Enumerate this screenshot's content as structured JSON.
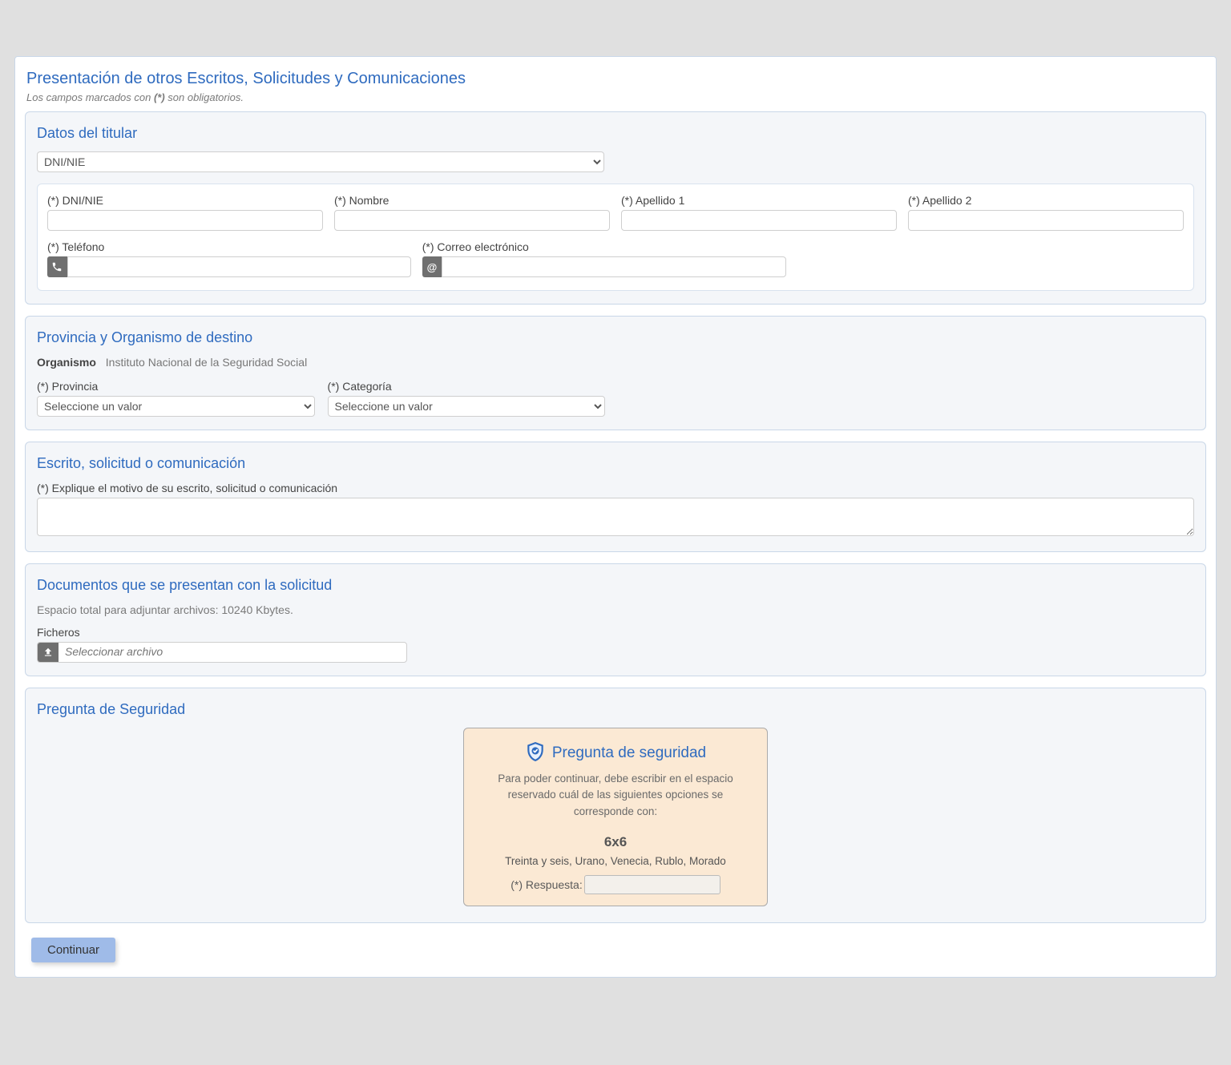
{
  "page": {
    "title": "Presentación de otros Escritos, Solicitudes y Comunicaciones",
    "subtitle_prefix": "Los campos marcados con ",
    "subtitle_marker": "(*)",
    "subtitle_suffix": " son obligatorios."
  },
  "titular": {
    "panel_title": "Datos del titular",
    "id_type_selected": "DNI/NIE",
    "fields": {
      "dni_label": "(*) DNI/NIE",
      "nombre_label": "(*) Nombre",
      "apellido1_label": "(*) Apellido 1",
      "apellido2_label": "(*) Apellido 2",
      "telefono_label": "(*) Teléfono",
      "email_label": "(*) Correo electrónico"
    },
    "icons": {
      "email_symbol": "@"
    }
  },
  "destino": {
    "panel_title": "Provincia y Organismo de destino",
    "organismo_label": "Organismo",
    "organismo_value": "Instituto Nacional de la Seguridad Social",
    "provincia_label": "(*) Provincia",
    "categoria_label": "(*) Categoría",
    "select_placeholder": "Seleccione un valor"
  },
  "escrito": {
    "panel_title": "Escrito, solicitud o comunicación",
    "motivo_label": "(*) Explique el motivo de su escrito, solicitud o comunicación"
  },
  "documentos": {
    "panel_title": "Documentos que se presentan con la solicitud",
    "espacio_text": "Espacio total para adjuntar archivos: 10240 Kbytes.",
    "ficheros_label": "Ficheros",
    "file_placeholder": "Seleccionar archivo"
  },
  "seguridad": {
    "panel_title": "Pregunta de Seguridad",
    "card_title": "Pregunta de seguridad",
    "description": "Para poder continuar, debe escribir en el espacio reservado cuál de las siguientes opciones se corresponde con:",
    "question": "6x6",
    "options": "Treinta y seis, Urano, Venecia, Rublo, Morado",
    "answer_label": "(*) Respuesta:"
  },
  "actions": {
    "continue_label": "Continuar"
  }
}
